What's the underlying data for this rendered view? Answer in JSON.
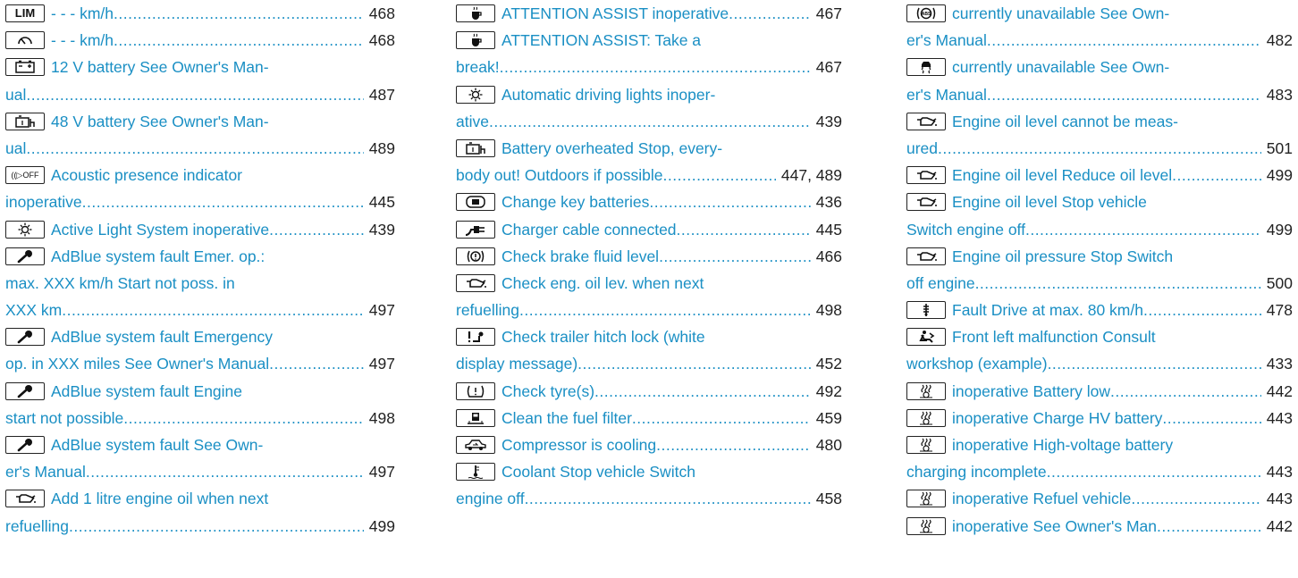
{
  "columns": [
    {
      "entries": [
        {
          "icon": "lim-icon",
          "label": "LIM",
          "lines": [
            "- - - km/h"
          ],
          "page": "468"
        },
        {
          "icon": "speedometer-icon",
          "lines": [
            "- - - km/h"
          ],
          "page": "468"
        },
        {
          "icon": "battery-12v-icon",
          "lines": [
            "12 V battery See Owner's Man-",
            "ual"
          ],
          "page": "487"
        },
        {
          "icon": "battery-48v-icon",
          "lines": [
            "48 V battery See Owner's Man-",
            "ual"
          ],
          "page": "489"
        },
        {
          "icon": "acoustic-off-icon",
          "label": "((▷OFF",
          "lines": [
            "Acoustic presence indicator",
            "inoperative"
          ],
          "page": "445"
        },
        {
          "icon": "light-icon",
          "lines": [
            "Active Light System inoperative"
          ],
          "page": "439"
        },
        {
          "icon": "wrench-icon",
          "lines": [
            "AdBlue system fault Emer. op.:",
            "max. XXX km/h Start not poss. in",
            "XXX km"
          ],
          "page": "497"
        },
        {
          "icon": "wrench-icon",
          "lines": [
            "AdBlue system fault Emergency",
            "op. in XXX miles See Owner's Manual"
          ],
          "page": "497"
        },
        {
          "icon": "wrench-icon",
          "lines": [
            "AdBlue system fault Engine",
            "start not possible"
          ],
          "page": "498"
        },
        {
          "icon": "wrench-icon",
          "lines": [
            "AdBlue system fault See Own-",
            "er's Manual"
          ],
          "page": "497"
        },
        {
          "icon": "oil-can-icon",
          "lines": [
            "Add 1 litre engine oil when next",
            "refuelling"
          ],
          "page": "499"
        }
      ]
    },
    {
      "entries": [
        {
          "icon": "coffee-cup-icon",
          "lines": [
            "ATTENTION ASSIST inoperative"
          ],
          "page": "467"
        },
        {
          "icon": "coffee-cup-icon",
          "lines": [
            "ATTENTION ASSIST: Take a",
            "break!"
          ],
          "page": "467"
        },
        {
          "icon": "light-icon",
          "lines": [
            "Automatic driving lights inoper-",
            "ative"
          ],
          "page": "439"
        },
        {
          "icon": "battery-48v-icon",
          "lines": [
            "Battery overheated Stop, every-",
            "body out! Outdoors if possible"
          ],
          "page": "447, 489"
        },
        {
          "icon": "key-battery-icon",
          "lines": [
            "Change key batteries"
          ],
          "page": "436"
        },
        {
          "icon": "charger-plug-icon",
          "lines": [
            "Charger cable connected"
          ],
          "page": "445"
        },
        {
          "icon": "brake-fluid-icon",
          "lines": [
            "Check brake fluid level"
          ],
          "page": "466"
        },
        {
          "icon": "oil-can-icon",
          "lines": [
            "Check eng. oil lev. when next",
            "refuelling"
          ],
          "page": "498"
        },
        {
          "icon": "trailer-hitch-icon",
          "lines": [
            "Check trailer hitch lock  (white",
            "display message)"
          ],
          "page": "452"
        },
        {
          "icon": "tyre-pressure-icon",
          "lines": [
            "Check tyre(s)"
          ],
          "page": "492"
        },
        {
          "icon": "fuel-filter-icon",
          "lines": [
            "Clean the fuel filter"
          ],
          "page": "459"
        },
        {
          "icon": "compressor-car-icon",
          "lines": [
            "Compressor is cooling"
          ],
          "page": "480"
        },
        {
          "icon": "coolant-thermometer-icon",
          "lines": [
            "Coolant Stop vehicle Switch",
            "engine off"
          ],
          "page": "458"
        }
      ]
    },
    {
      "entries": [
        {
          "icon": "abs-icon",
          "lines": [
            "currently unavailable See Own-",
            "er's Manual"
          ],
          "page": "482"
        },
        {
          "icon": "skid-car-icon",
          "lines": [
            "currently unavailable See Own-",
            "er's Manual"
          ],
          "page": "483"
        },
        {
          "icon": "oil-can-icon",
          "lines": [
            "Engine oil level cannot be meas-",
            "ured"
          ],
          "page": "501"
        },
        {
          "icon": "oil-can-icon",
          "lines": [
            "Engine oil level Reduce oil level"
          ],
          "page": "499"
        },
        {
          "icon": "oil-can-icon",
          "lines": [
            "Engine oil level Stop vehicle",
            "Switch engine off"
          ],
          "page": "499"
        },
        {
          "icon": "oil-can-icon",
          "lines": [
            "Engine oil pressure Stop Switch",
            "off engine"
          ],
          "page": "500"
        },
        {
          "icon": "drive-fault-icon",
          "lines": [
            "Fault Drive at max. 80 km/h"
          ],
          "page": "478"
        },
        {
          "icon": "seat-occupant-icon",
          "lines": [
            "Front left malfunction Consult",
            "workshop (example)"
          ],
          "page": "433"
        },
        {
          "icon": "aux-heating-icon",
          "lines": [
            "inoperative Battery low"
          ],
          "page": "442"
        },
        {
          "icon": "aux-heating-icon",
          "lines": [
            "inoperative Charge HV battery"
          ],
          "page": "443"
        },
        {
          "icon": "aux-heating-icon",
          "lines": [
            "inoperative High-voltage battery",
            "charging incomplete"
          ],
          "page": "443"
        },
        {
          "icon": "aux-heating-icon",
          "lines": [
            "inoperative Refuel vehicle"
          ],
          "page": "443"
        },
        {
          "icon": "aux-heating-icon",
          "lines": [
            "inoperative See Owner's Man"
          ],
          "page": "442"
        }
      ]
    }
  ]
}
